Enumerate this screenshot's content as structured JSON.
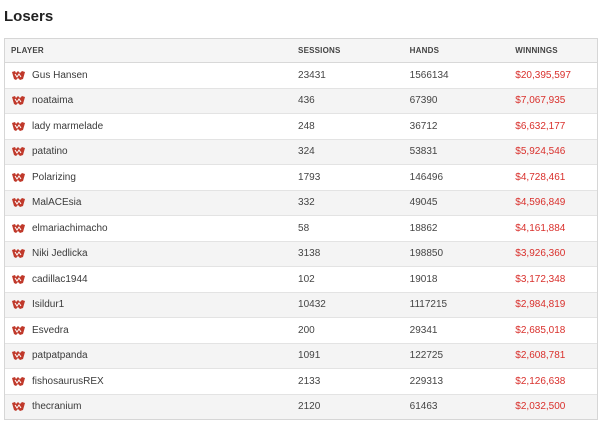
{
  "title": "Losers",
  "columns": {
    "player": "PLAYER",
    "sessions": "SESSIONS",
    "hands": "HANDS",
    "winnings": "WINNINGS"
  },
  "icons": {
    "player_logo": "site-logo-icon",
    "logo_color": "#c0392b"
  },
  "rows": [
    {
      "player": "Gus Hansen",
      "sessions": "23431",
      "hands": "1566134",
      "winnings": "$20,395,597"
    },
    {
      "player": "noataima",
      "sessions": "436",
      "hands": "67390",
      "winnings": "$7,067,935"
    },
    {
      "player": "lady marmelade",
      "sessions": "248",
      "hands": "36712",
      "winnings": "$6,632,177"
    },
    {
      "player": "patatino",
      "sessions": "324",
      "hands": "53831",
      "winnings": "$5,924,546"
    },
    {
      "player": "Polarizing",
      "sessions": "1793",
      "hands": "146496",
      "winnings": "$4,728,461"
    },
    {
      "player": "MalACEsia",
      "sessions": "332",
      "hands": "49045",
      "winnings": "$4,596,849"
    },
    {
      "player": "elmariachimacho",
      "sessions": "58",
      "hands": "18862",
      "winnings": "$4,161,884"
    },
    {
      "player": "Niki Jedlicka",
      "sessions": "3138",
      "hands": "198850",
      "winnings": "$3,926,360"
    },
    {
      "player": "cadillac1944",
      "sessions": "102",
      "hands": "19018",
      "winnings": "$3,172,348"
    },
    {
      "player": "Isildur1",
      "sessions": "10432",
      "hands": "1117215",
      "winnings": "$2,984,819"
    },
    {
      "player": "Esvedra",
      "sessions": "200",
      "hands": "29341",
      "winnings": "$2,685,018"
    },
    {
      "player": "patpatpanda",
      "sessions": "1091",
      "hands": "122725",
      "winnings": "$2,608,781"
    },
    {
      "player": "fishosaurusREX",
      "sessions": "2133",
      "hands": "229313",
      "winnings": "$2,126,638"
    },
    {
      "player": "thecranium",
      "sessions": "2120",
      "hands": "61463",
      "winnings": "$2,032,500"
    }
  ]
}
